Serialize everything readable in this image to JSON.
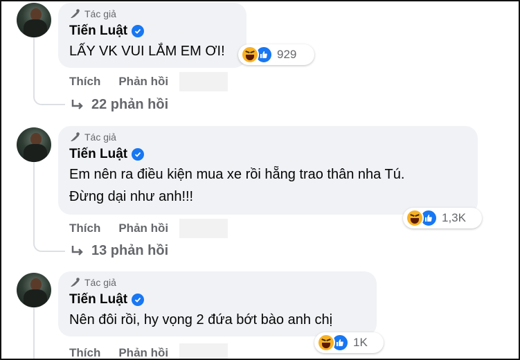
{
  "comments": [
    {
      "author_tag": "Tác giả",
      "name": "Tiến Luật",
      "text_lines": [
        "LẤY VK VUI LẮM EM ƠI!"
      ],
      "reaction_count": "929",
      "like_label": "Thích",
      "reply_label": "Phản hồi",
      "replies_label": "22 phản hồi"
    },
    {
      "author_tag": "Tác giả",
      "name": "Tiến Luật",
      "text_lines": [
        "Em nên ra điều kiện mua xe rồi hẵng trao thân nha Tú.",
        "Đừng dại như anh!!!"
      ],
      "reaction_count": "1,3K",
      "like_label": "Thích",
      "reply_label": "Phản hồi",
      "replies_label": "13 phản hồi"
    },
    {
      "author_tag": "Tác giả",
      "name": "Tiến Luật",
      "text_lines": [
        "Nên đôi rồi, hy vọng 2 đứa bớt bào anh chị"
      ],
      "reaction_count": "1K",
      "like_label": "Thích",
      "reply_label": "Phản hồi"
    }
  ],
  "icons": {
    "author": "microphone-pen-icon",
    "verified": "verified-badge-icon",
    "reply_arrow": "reply-arrow-icon",
    "reactions": [
      "haha-reaction-icon",
      "like-reaction-icon"
    ]
  },
  "colors": {
    "bubble": "#f0f2f5",
    "verified": "#1877f2",
    "secondary_text": "#65676b",
    "haha": "#f7b125",
    "like": "#1877f2"
  }
}
